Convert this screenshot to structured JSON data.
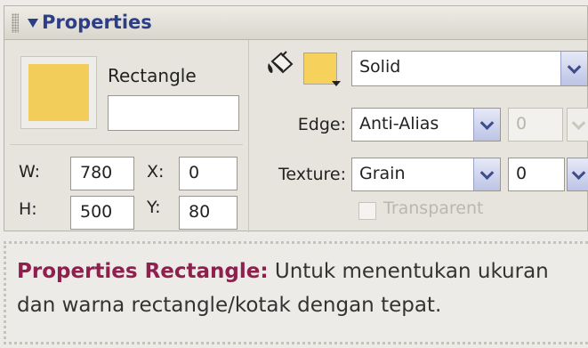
{
  "panel": {
    "title": "Properties",
    "object_type": "Rectangle",
    "name_value": "",
    "fill_color": "#f6d15c",
    "w_label": "W:",
    "w_value": "780",
    "h_label": "H:",
    "h_value": "500",
    "x_label": "X:",
    "x_value": "0",
    "y_label": "Y:",
    "y_value": "80",
    "fill_type": "Solid",
    "edge_label": "Edge:",
    "edge_value": "Anti-Alias",
    "edge_amount": "0",
    "texture_label": "Texture:",
    "texture_value": "Grain",
    "texture_amount": "0",
    "transparent_label": "Transparent"
  },
  "caption": {
    "highlight": "Properties Rectangle:",
    "text": " Untuk menentukan ukuran dan warna rectangle/kotak dengan tepat."
  },
  "colors": {
    "accent": "#2c3e86",
    "caption_highlight": "#8f1f4c",
    "fill": "#f6d15c"
  }
}
